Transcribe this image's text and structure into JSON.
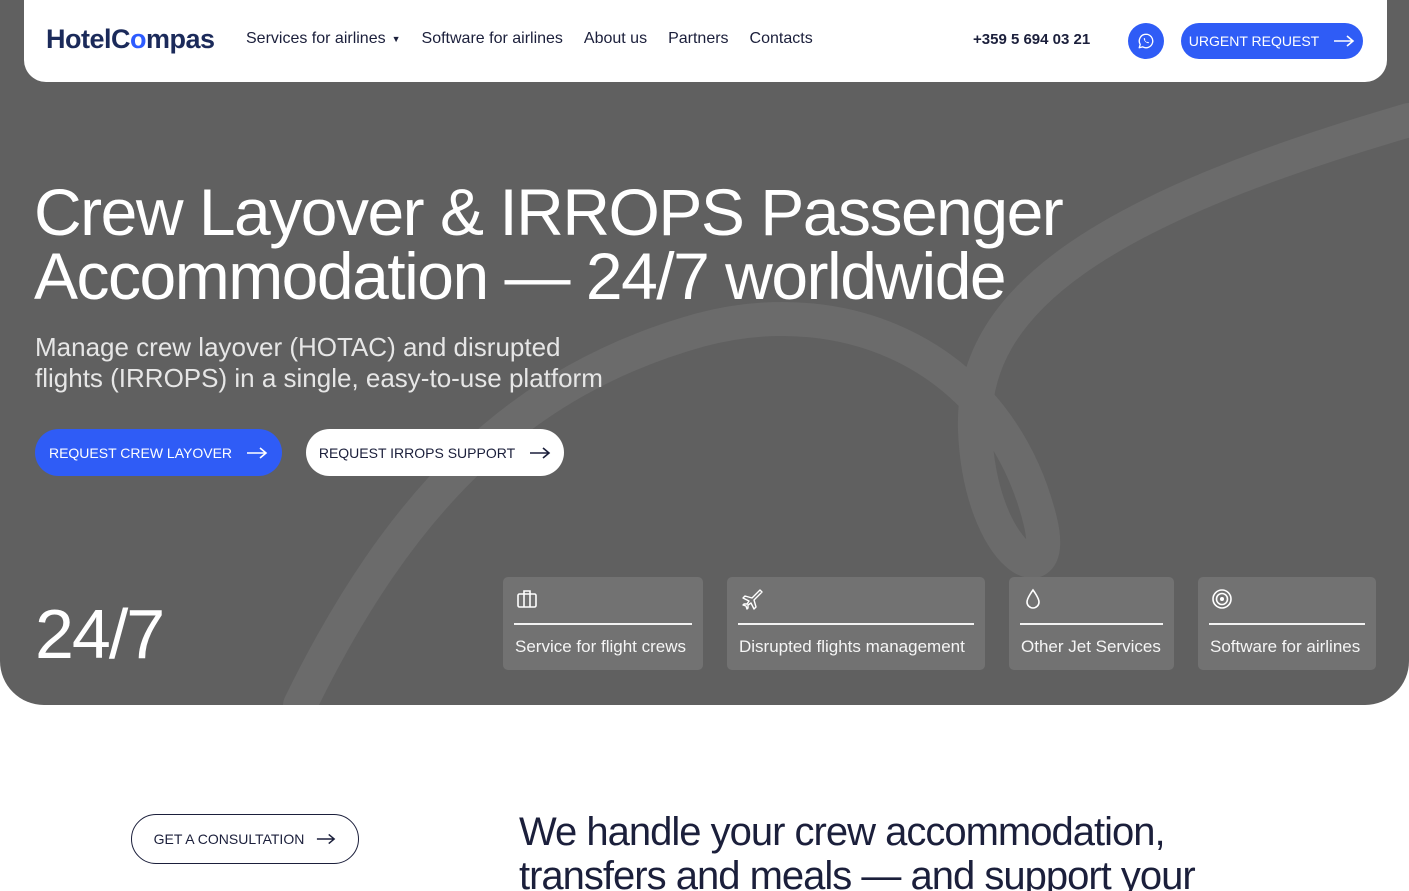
{
  "header": {
    "logo_text_a": "HotelC",
    "logo_text_o": "o",
    "logo_text_b": "mpas",
    "nav": [
      {
        "label": "Services for airlines",
        "has_dropdown": true
      },
      {
        "label": "Software for airlines"
      },
      {
        "label": "About us"
      },
      {
        "label": "Partners"
      },
      {
        "label": "Contacts"
      }
    ],
    "phone": "+359 5 694 03 21",
    "whatsapp_icon": "whatsapp-icon",
    "urgent_label": "URGENT REQUEST"
  },
  "hero": {
    "title_line1": "Crew Layover & IRROPS Passenger",
    "title_line2": "Accommodation — 24/7 worldwide",
    "subtitle_line1": "Manage crew layover (HOTAC) and disrupted",
    "subtitle_line2": "flights (IRROPS) in a single, easy-to-use platform",
    "primary_cta": "REQUEST CREW LAYOVER",
    "secondary_cta": "REQUEST IRROPS SUPPORT",
    "stat": "24/7"
  },
  "cards": [
    {
      "label": "Service for flight crews",
      "icon": "luggage-icon"
    },
    {
      "label": "Disrupted flights management",
      "icon": "airplane-icon"
    },
    {
      "label": "Other Jet Services",
      "icon": "fuel-drop-icon"
    },
    {
      "label": "Software for airlines",
      "icon": "target-icon"
    }
  ],
  "section2": {
    "consult_label": "GET A CONSULTATION",
    "text_line1": "We handle your crew accommodation,",
    "text_line2": "transfers and meals — and support your"
  },
  "colors": {
    "accent": "#2f5cf6",
    "hero_bg": "#606060",
    "navy": "#1b1f3b"
  }
}
